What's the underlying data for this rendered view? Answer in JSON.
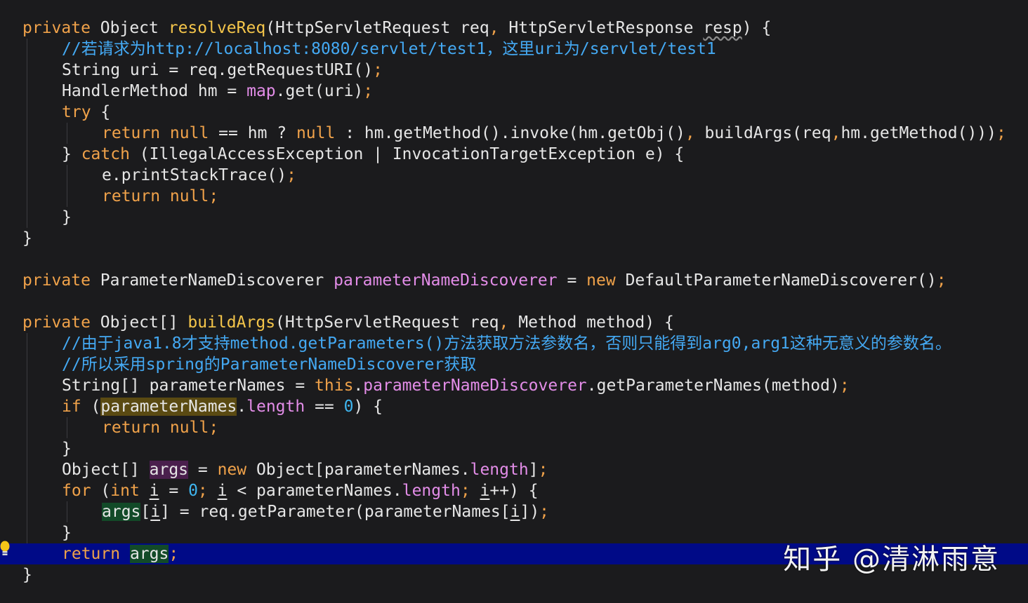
{
  "editor": {
    "background": "#1b1b1d",
    "current_line_background": "#000a87",
    "token_colors": {
      "default": "#e6e6e6",
      "keyword": "#f0a24a",
      "method_declaration": "#f4c54a",
      "field": "#e38de8",
      "number": "#3fb6f0",
      "comment": "#44a9f3"
    },
    "highlight_colors": {
      "read_usage": "#5a4a12",
      "write_usage": "#4a1f4d",
      "variable_usage": "#124a28"
    },
    "gutter": {
      "intention_icon": "lightbulb-icon",
      "intention_icon_color": "#f5c518"
    },
    "lines": [
      {
        "tokens": [
          [
            "private",
            "kw"
          ],
          [
            " Object ",
            ""
          ],
          [
            "resolveReq",
            "fn"
          ],
          [
            "(HttpServletRequest req",
            ""
          ],
          [
            ",",
            "kw"
          ],
          [
            " HttpServletResponse ",
            ""
          ],
          [
            "resp",
            "wavy"
          ],
          [
            ") {",
            ""
          ]
        ]
      },
      {
        "tokens": [
          [
            "//若请求为http://localhost:8080/servlet/test1，这里uri为/servlet/test1",
            "cm"
          ]
        ]
      },
      {
        "tokens": [
          [
            "String uri = req.getRequestURI()",
            ""
          ],
          [
            ";",
            "kw"
          ]
        ]
      },
      {
        "tokens": [
          [
            "HandlerMethod hm = ",
            ""
          ],
          [
            "map",
            "fld"
          ],
          [
            ".get(uri)",
            ""
          ],
          [
            ";",
            "kw"
          ]
        ]
      },
      {
        "tokens": [
          [
            "try",
            "kw"
          ],
          [
            " {",
            ""
          ]
        ]
      },
      {
        "tokens": [
          [
            "return null",
            "kw"
          ],
          [
            " == hm ? ",
            ""
          ],
          [
            "null",
            "kw"
          ],
          [
            " : hm.getMethod().invoke(hm.getObj()",
            ""
          ],
          [
            ",",
            "kw"
          ],
          [
            " buildArgs(req",
            ""
          ],
          [
            ",",
            "kw"
          ],
          [
            "hm.getMethod()))",
            ""
          ],
          [
            ";",
            "kw"
          ]
        ]
      },
      {
        "tokens": [
          [
            "} ",
            ""
          ],
          [
            "catch",
            "kw"
          ],
          [
            " (IllegalAccessException | InvocationTargetException e) {",
            ""
          ]
        ]
      },
      {
        "tokens": [
          [
            "e.printStackTrace()",
            ""
          ],
          [
            ";",
            "kw"
          ]
        ]
      },
      {
        "tokens": [
          [
            "return null;",
            "kw"
          ]
        ]
      },
      {
        "tokens": [
          [
            "}",
            ""
          ]
        ]
      },
      {
        "tokens": [
          [
            "}",
            ""
          ]
        ]
      },
      {
        "tokens": []
      },
      {
        "tokens": [
          [
            "private",
            "kw"
          ],
          [
            " ParameterNameDiscoverer ",
            ""
          ],
          [
            "parameterNameDiscoverer",
            "fld"
          ],
          [
            " = ",
            ""
          ],
          [
            "new",
            "kw"
          ],
          [
            " DefaultParameterNameDiscoverer()",
            ""
          ],
          [
            ";",
            "kw"
          ]
        ]
      },
      {
        "tokens": []
      },
      {
        "tokens": [
          [
            "private",
            "kw"
          ],
          [
            " Object[] ",
            ""
          ],
          [
            "buildArgs",
            "fn"
          ],
          [
            "(HttpServletRequest req",
            ""
          ],
          [
            ",",
            "kw"
          ],
          [
            " Method method) {",
            ""
          ]
        ]
      },
      {
        "tokens": [
          [
            "//由于java1.8才支持method.getParameters()方法获取方法参数名，否则只能得到arg0,arg1这种无意义的参数名。",
            "cm"
          ]
        ]
      },
      {
        "tokens": [
          [
            "//所以采用spring的ParameterNameDiscoverer获取",
            "cm"
          ]
        ]
      },
      {
        "tokens": [
          [
            "String[] parameterNames = ",
            ""
          ],
          [
            "this",
            "kw"
          ],
          [
            ".",
            ""
          ],
          [
            "parameterNameDiscoverer",
            "fld"
          ],
          [
            ".getParameterNames(method)",
            ""
          ],
          [
            ";",
            "kw"
          ]
        ]
      },
      {
        "tokens": [
          [
            "if",
            "kw"
          ],
          [
            " (",
            ""
          ],
          [
            "parameterNames",
            "hl-read"
          ],
          [
            ".",
            ""
          ],
          [
            "length",
            "fld"
          ],
          [
            " == ",
            ""
          ],
          [
            "0",
            "num"
          ],
          [
            ") {",
            ""
          ]
        ]
      },
      {
        "tokens": [
          [
            "return null;",
            "kw"
          ]
        ]
      },
      {
        "tokens": [
          [
            "}",
            ""
          ]
        ]
      },
      {
        "tokens": [
          [
            "Object[] ",
            ""
          ],
          [
            "args",
            "hl-write"
          ],
          [
            " = ",
            ""
          ],
          [
            "new",
            "kw"
          ],
          [
            " Object[parameterNames.",
            ""
          ],
          [
            "length",
            "fld"
          ],
          [
            "]",
            ""
          ],
          [
            ";",
            "kw"
          ]
        ]
      },
      {
        "tokens": [
          [
            "for",
            "kw"
          ],
          [
            " (",
            ""
          ],
          [
            "int",
            "kw"
          ],
          [
            " ",
            ""
          ],
          [
            "i",
            "ul"
          ],
          [
            " = ",
            ""
          ],
          [
            "0",
            "num"
          ],
          [
            "; ",
            "kw"
          ],
          [
            "i",
            "ul"
          ],
          [
            " < parameterNames.",
            ""
          ],
          [
            "length",
            "fld"
          ],
          [
            "; ",
            "kw"
          ],
          [
            "i",
            "ul"
          ],
          [
            "++) {",
            ""
          ]
        ]
      },
      {
        "tokens": [
          [
            "args",
            "hl-green"
          ],
          [
            "[",
            ""
          ],
          [
            "i",
            "ul"
          ],
          [
            "] = req.getParameter(parameterNames[",
            ""
          ],
          [
            "i",
            "ul"
          ],
          [
            "])",
            ""
          ],
          [
            ";",
            "kw"
          ]
        ]
      },
      {
        "tokens": [
          [
            "}",
            ""
          ]
        ]
      },
      {
        "tokens": [
          [
            "return",
            "kw"
          ],
          [
            " ",
            ""
          ],
          [
            "args",
            "hl-green"
          ],
          [
            ";",
            "kw"
          ]
        ]
      },
      {
        "tokens": [
          [
            "}",
            ""
          ]
        ]
      }
    ]
  },
  "watermark": {
    "text": "知乎 @清淋雨意"
  }
}
